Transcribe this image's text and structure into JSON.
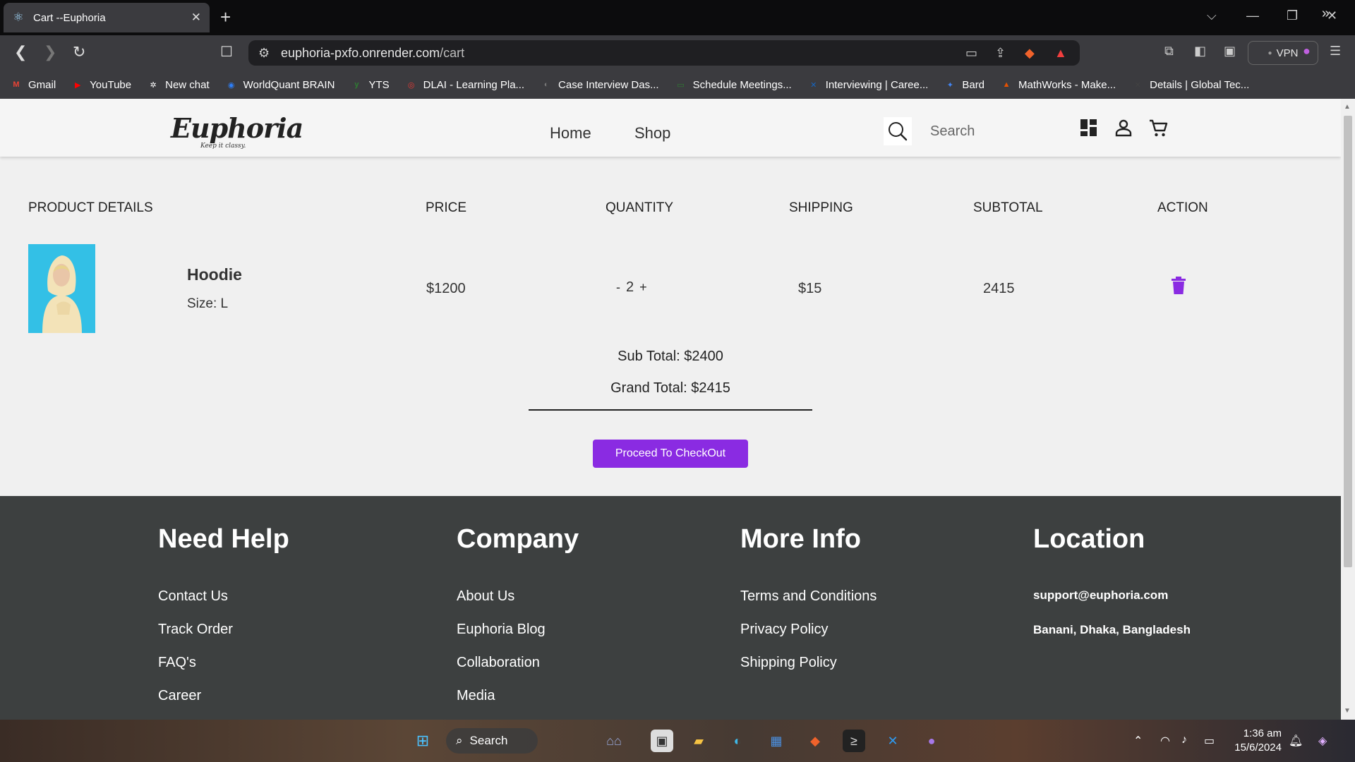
{
  "browser": {
    "tab_title": "Cart --Euphoria",
    "tab_close": "✕",
    "new_tab": "+",
    "url_host": "euphoria-pxfo.onrender.com",
    "url_path": "/cart",
    "vpn_label": "VPN",
    "bookmarks": [
      {
        "label": "Gmail",
        "icon": "gmail-icon",
        "color": "#ea4335",
        "glyph": "M"
      },
      {
        "label": "YouTube",
        "icon": "youtube-icon",
        "color": "#ff0000",
        "glyph": "▶"
      },
      {
        "label": "New chat",
        "icon": "chatgpt-icon",
        "color": "#ffffff",
        "glyph": "✲"
      },
      {
        "label": "WorldQuant BRAIN",
        "icon": "worldquant-icon",
        "color": "#2d7ff9",
        "glyph": "◉"
      },
      {
        "label": "YTS",
        "icon": "yts-icon",
        "color": "#2e7d32",
        "glyph": "y"
      },
      {
        "label": "DLAI - Learning Pla...",
        "icon": "dlai-icon",
        "color": "#e53935",
        "glyph": "◎"
      },
      {
        "label": "Case Interview Das...",
        "icon": "case-interview-icon",
        "color": "#777777",
        "glyph": "◐"
      },
      {
        "label": "Schedule Meetings...",
        "icon": "schedule-icon",
        "color": "#2e7d32",
        "glyph": "▭"
      },
      {
        "label": "Interviewing | Caree...",
        "icon": "interviewing-icon",
        "color": "#1565c0",
        "glyph": "✕"
      },
      {
        "label": "Bard",
        "icon": "bard-icon",
        "color": "#4285f4",
        "glyph": "✦"
      },
      {
        "label": "MathWorks - Make...",
        "icon": "mathworks-icon",
        "color": "#e65100",
        "glyph": "▲"
      },
      {
        "label": "Details | Global Tec...",
        "icon": "global-tec-icon",
        "color": "#424242",
        "glyph": "✕"
      }
    ]
  },
  "header": {
    "logo": "Euphoria",
    "logo_tagline": "Keep it classy.",
    "nav": [
      "Home",
      "Shop"
    ],
    "search_placeholder": "Search"
  },
  "cart": {
    "columns": [
      "PRODUCT DETAILS",
      "PRICE",
      "QUANTITY",
      "SHIPPING",
      "SUBTOTAL",
      "ACTION"
    ],
    "items": [
      {
        "name": "Hoodie",
        "size": "Size: L",
        "price": "$1200",
        "qty_minus": "-",
        "quantity": "2",
        "qty_plus": "+",
        "shipping": "$15",
        "subtotal": "2415"
      }
    ],
    "sub_total": "Sub Total: $2400",
    "grand_total": "Grand Total: $2415",
    "checkout_label": "Proceed To CheckOut",
    "accent_color": "#8a2be2"
  },
  "footer": {
    "need_help": {
      "title": "Need Help",
      "links": [
        "Contact Us",
        "Track Order",
        "FAQ's",
        "Career"
      ]
    },
    "company": {
      "title": "Company",
      "links": [
        "About Us",
        "Euphoria Blog",
        "Collaboration",
        "Media"
      ]
    },
    "more_info": {
      "title": "More Info",
      "links": [
        "Terms and Conditions",
        "Privacy Policy",
        "Shipping Policy"
      ]
    },
    "location": {
      "title": "Location",
      "email": "support@euphoria.com",
      "address": "Banani, Dhaka, Bangladesh"
    }
  },
  "taskbar": {
    "search_label": "Search",
    "time": "1:36 am",
    "date": "15/6/2024"
  }
}
